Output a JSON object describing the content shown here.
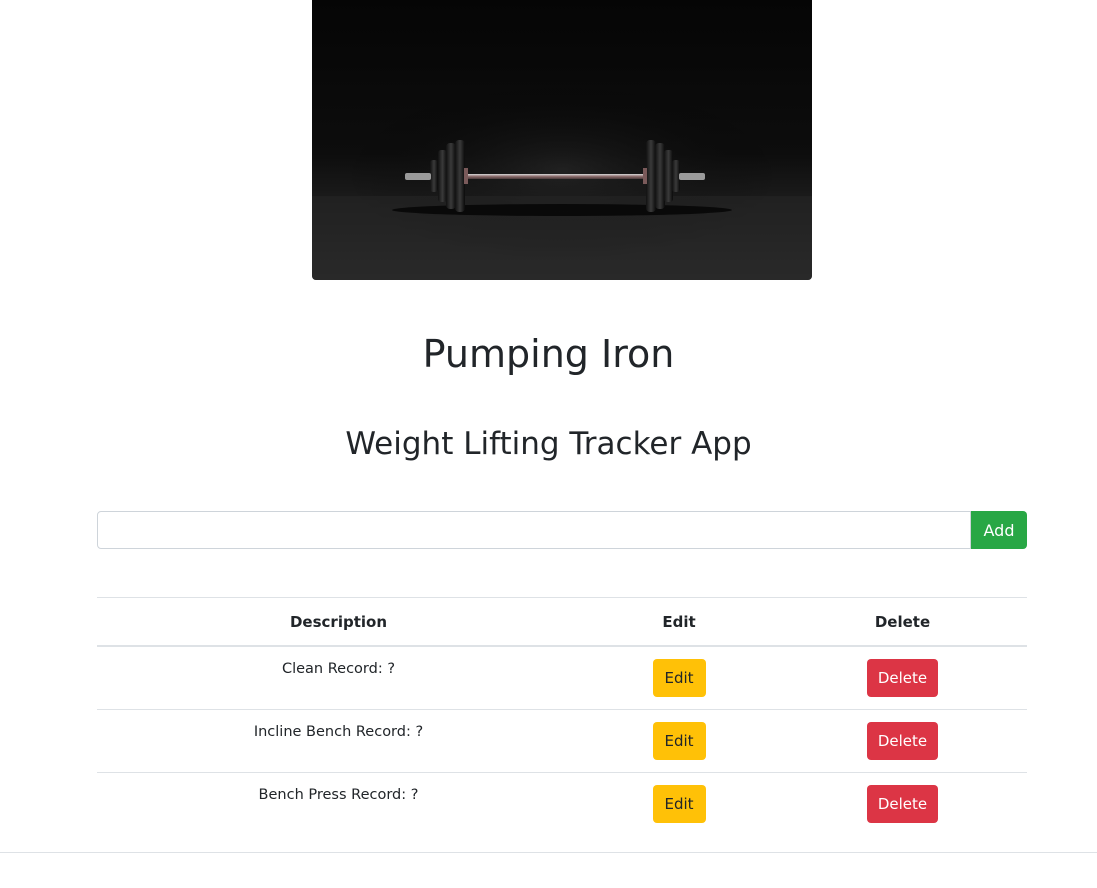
{
  "hero": {
    "image": "barbell-photo",
    "background": "#0b0b0b"
  },
  "header": {
    "title": "Pumping Iron",
    "subtitle": "Weight Lifting Tracker App"
  },
  "add_form": {
    "input_value": "",
    "input_placeholder": "",
    "add_label": "Add"
  },
  "table": {
    "headers": [
      "Description",
      "Edit",
      "Delete"
    ],
    "rows": [
      {
        "description": "Clean Record: ?",
        "edit_label": "Edit",
        "delete_label": "Delete"
      },
      {
        "description": "Incline Bench Record: ?",
        "edit_label": "Edit",
        "delete_label": "Delete"
      },
      {
        "description": "Bench Press Record: ?",
        "edit_label": "Edit",
        "delete_label": "Delete"
      }
    ]
  },
  "colors": {
    "add_button": "#28a745",
    "edit_button": "#ffc107",
    "delete_button": "#dc3545",
    "text": "#212529"
  }
}
